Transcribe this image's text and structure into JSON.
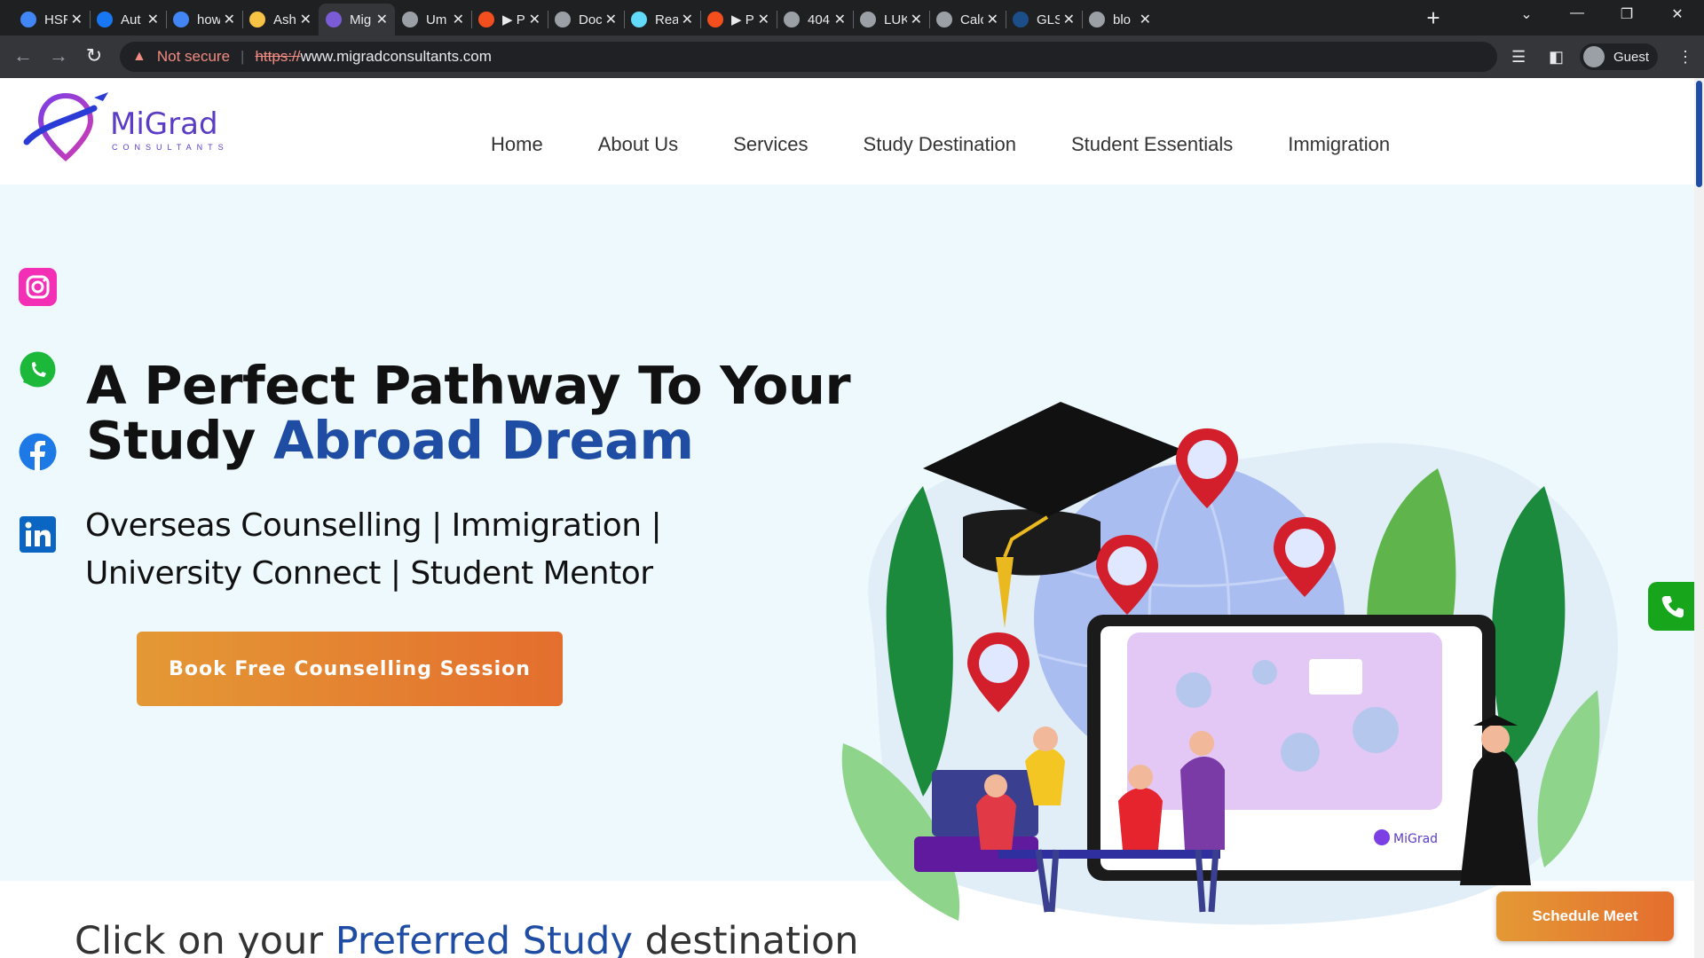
{
  "browser": {
    "tabs": [
      {
        "label": "HSR",
        "icon": "google-icon",
        "color": "#4285f4"
      },
      {
        "label": "Aut",
        "icon": "meta-icon",
        "color": "#1877f2"
      },
      {
        "label": "how",
        "icon": "google-icon",
        "color": "#4285f4"
      },
      {
        "label": "Ash",
        "icon": "tab-app-icon",
        "color": "#f6c344"
      },
      {
        "label": "Mig",
        "icon": "migrad-favicon-icon",
        "color": "#7b5cd6",
        "active": true
      },
      {
        "label": "Um",
        "icon": "globe-icon",
        "color": "#9aa0a6"
      },
      {
        "label": "▶ P",
        "icon": "figma-icon",
        "color": "#f24e1e"
      },
      {
        "label": "Doc",
        "icon": "globe-icon",
        "color": "#9aa0a6"
      },
      {
        "label": "Rea",
        "icon": "react-icon",
        "color": "#61dafb"
      },
      {
        "label": "▶ P",
        "icon": "figma-icon",
        "color": "#f24e1e"
      },
      {
        "label": "404",
        "icon": "globe-icon",
        "color": "#9aa0a6"
      },
      {
        "label": "LUK",
        "icon": "globe-icon",
        "color": "#9aa0a6"
      },
      {
        "label": "Calc",
        "icon": "globe-icon",
        "color": "#9aa0a6"
      },
      {
        "label": "GLS",
        "icon": "gls-icon",
        "color": "#1c4f8a"
      },
      {
        "label": "blo",
        "icon": "globe-icon",
        "color": "#9aa0a6"
      }
    ],
    "new_tab": "+",
    "url_warning": "Not secure",
    "url_scheme": "https://",
    "url_host": "www.migradconsultants.com",
    "profile": "Guest"
  },
  "site": {
    "brand": "MiGrad",
    "brand_sub": "CONSULTANTS",
    "nav": [
      "Home",
      "About Us",
      "Services",
      "Study Destination",
      "Student Essentials",
      "Immigration"
    ],
    "hero": {
      "title_line1": "A Perfect Pathway To Your",
      "title_line2_plain": "Study ",
      "title_line2_highlight": "Abroad Dream",
      "subtitle_line1": "Overseas Counselling | Immigration |",
      "subtitle_line2": "University Connect | Student Mentor",
      "cta": "Book Free Counselling Session"
    },
    "socials": [
      "instagram",
      "whatsapp",
      "facebook",
      "linkedin"
    ],
    "schedule_button": "Schedule Meet",
    "section_title_plain1": "Click on your ",
    "section_title_highlight": "Preferred Study",
    "section_title_plain2": " destination",
    "illustration_brand": "MiGrad"
  },
  "colors": {
    "accent_blue": "#1e4da3",
    "cta_orange": "#e4862f",
    "hero_bg": "#eef9fd",
    "call_green": "#17a51b"
  }
}
